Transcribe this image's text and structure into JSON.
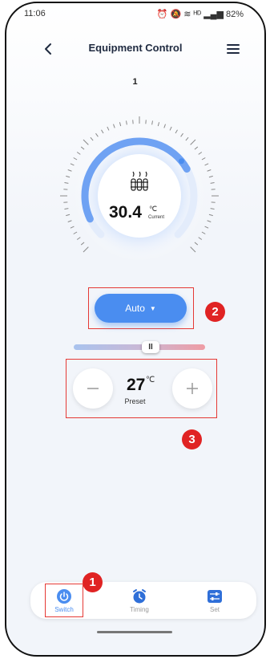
{
  "status_bar": {
    "time": "11:06",
    "icons": "⏰ 🔕 ≋ ᴴᴰ ▂▄▆ 82%",
    "battery": "82%"
  },
  "header": {
    "title": "Equipment Control",
    "back_icon": "chevron-left-icon",
    "menu_icon": "hamburger-menu-icon"
  },
  "device": {
    "name": "1"
  },
  "dial": {
    "current_temp": "30.4",
    "unit": "℃",
    "label": "Current",
    "icon": "heater-icon",
    "level": 0.65,
    "colors": {
      "active": "#4a8df0",
      "track": "#dfe9fb"
    }
  },
  "mode": {
    "label": "Auto",
    "caret": "▼",
    "color": "#4a8df0"
  },
  "slider": {
    "handle_label": "II",
    "position": 0.58
  },
  "preset": {
    "value": "27",
    "unit": "℃",
    "label": "Preset",
    "minus": "−",
    "plus": "+"
  },
  "annotations": {
    "badge_1": "1",
    "badge_2": "2",
    "badge_3": "3",
    "highlight_color": "#e53935"
  },
  "tabs": [
    {
      "label": "Switch",
      "icon": "power-icon",
      "active": true
    },
    {
      "label": "Timing",
      "icon": "alarm-clock-icon",
      "active": false
    },
    {
      "label": "Set",
      "icon": "sliders-icon",
      "active": false
    }
  ]
}
